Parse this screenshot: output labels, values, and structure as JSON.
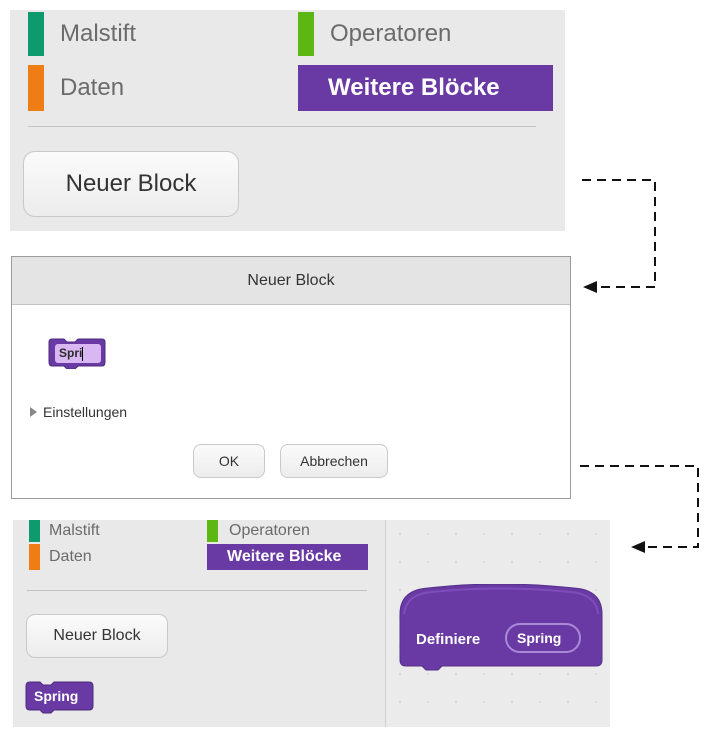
{
  "top_panel": {
    "categories": [
      {
        "label": "Malstift",
        "color": "#0e9a6c"
      },
      {
        "label": "Daten",
        "color": "#ee7d16"
      },
      {
        "label": "Operatoren",
        "color": "#5cb712"
      },
      {
        "label": "Weitere Blöcke",
        "color": "#6a3aa4",
        "selected": true
      }
    ],
    "new_block_button": "Neuer Block"
  },
  "dialog": {
    "title": "Neuer Block",
    "block_input_value": "Spri",
    "settings_label": "Einstellungen",
    "ok_label": "OK",
    "cancel_label": "Abbrechen"
  },
  "bottom_panel": {
    "categories": [
      {
        "label": "Malstift",
        "color": "#0e9a6c"
      },
      {
        "label": "Daten",
        "color": "#ee7d16"
      },
      {
        "label": "Operatoren",
        "color": "#5cb712"
      },
      {
        "label": "Weitere Blöcke",
        "color": "#6a3aa4",
        "selected": true
      }
    ],
    "new_block_button": "Neuer Block",
    "palette_block": "Spring",
    "define_block": {
      "keyword": "Definiere",
      "name": "Spring"
    }
  },
  "colors": {
    "block_purple": "#6a3aa4",
    "block_purple_light": "#8a5cc8",
    "panel_bg": "#e9e9e9",
    "arrow": "#111111"
  },
  "icons": [
    "triangle-right-icon",
    "arrow-left-icon"
  ]
}
